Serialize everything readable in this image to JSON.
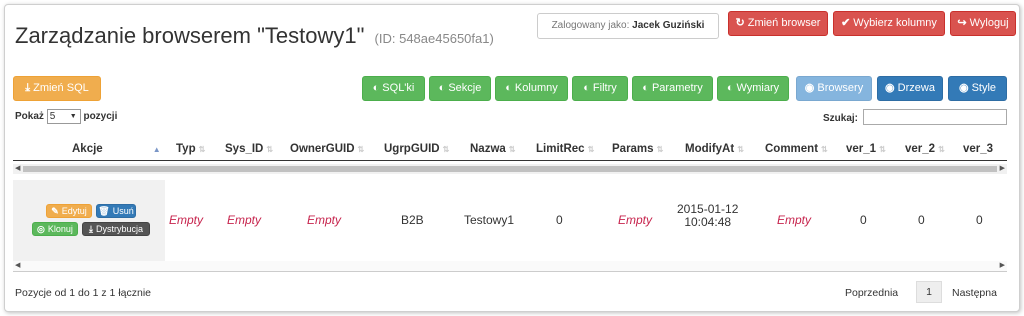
{
  "header": {
    "title": "Zarządzanie browserem \"Testowy1\"",
    "id_text": "(ID: 548ae45650fa1)",
    "logged_label": "Zalogowany jako:",
    "logged_user": "Jacek Guziński",
    "change_browser": "Zmień browser",
    "choose_columns": "Wybierz kolumny",
    "logout": "Wyloguj"
  },
  "toolbar": {
    "change_sql": "Zmień SQL",
    "sqls": "SQL'ki",
    "sections": "Sekcje",
    "columns": "Kolumny",
    "filters": "Filtry",
    "params": "Parametry",
    "dimensions": "Wymiary",
    "browsers": "Browsery",
    "trees": "Drzewa",
    "styles": "Style"
  },
  "controls": {
    "show_label": "Pokaż",
    "page_size": "5",
    "positions_label": "pozycji",
    "search_label": "Szukaj:"
  },
  "table": {
    "headers": [
      "Akcje",
      "Typ",
      "Sys_ID",
      "OwnerGUID",
      "UgrpGUID",
      "Nazwa",
      "LimitRec",
      "Params",
      "ModifyAt",
      "Comment",
      "ver_1",
      "ver_2",
      "ver_3"
    ],
    "row": {
      "actions": [
        "Edytuj",
        "Usuń",
        "Klonuj",
        "Dystrybucja"
      ],
      "typ": "Empty",
      "sys_id": "Empty",
      "owner": "Empty",
      "ugrp": "B2B",
      "nazwa": "Testowy1",
      "limitrec": "0",
      "params": "Empty",
      "modify_date": "2015-01-12",
      "modify_time": "10:04:48",
      "comment": "Empty",
      "ver1": "0",
      "ver2": "0",
      "ver3": "0"
    }
  },
  "footer": {
    "info": "Pozycje od 1 do 1 z 1 łącznie",
    "prev": "Poprzednia",
    "page": "1",
    "next": "Następna"
  },
  "colors": {
    "danger": "#d9534f",
    "success": "#5cb85c",
    "warning": "#f0ad4e",
    "primary": "#337ab7",
    "empty_text": "#c7254e"
  }
}
